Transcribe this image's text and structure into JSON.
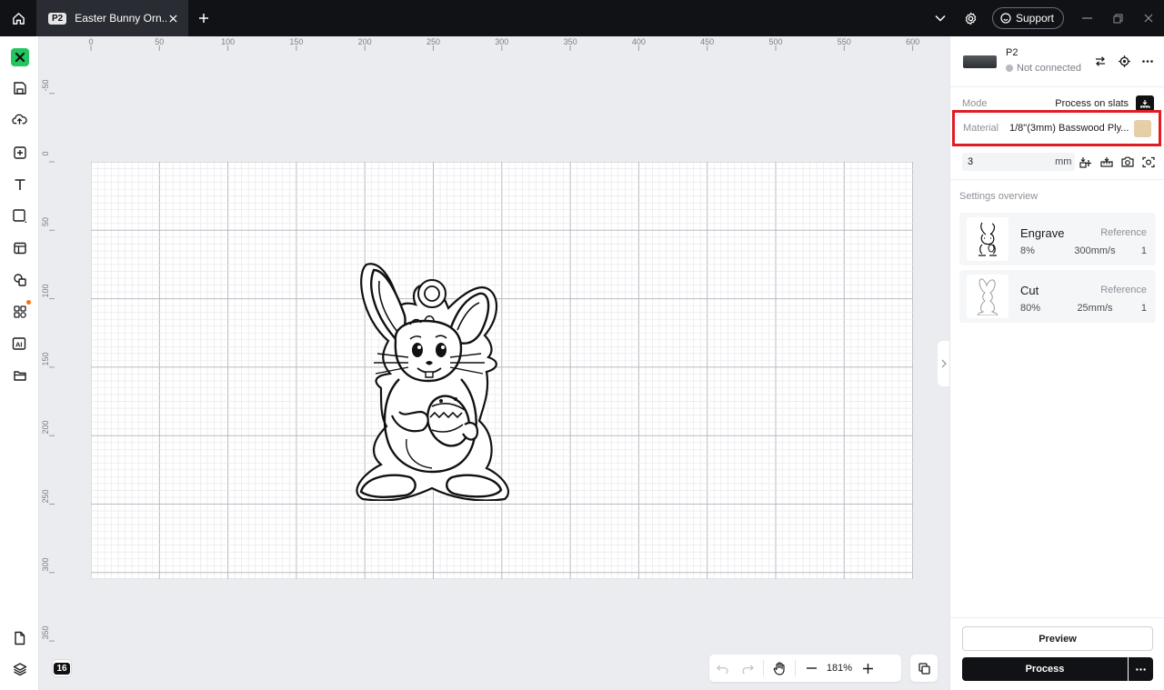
{
  "tab": {
    "badge": "P2",
    "title": "Easter Bunny Orn..."
  },
  "topbar": {
    "support_label": "Support"
  },
  "ruler": {
    "h_labels": [
      "0",
      "50",
      "100",
      "150",
      "200",
      "250",
      "300",
      "350",
      "400",
      "450",
      "500",
      "550",
      "600"
    ],
    "v_labels": [
      "-50",
      "0",
      "50",
      "100",
      "150",
      "200",
      "250",
      "300",
      "350"
    ]
  },
  "canvas": {
    "layers_count": "16",
    "zoom": "181%"
  },
  "device": {
    "name": "P2",
    "status": "Not connected"
  },
  "mode": {
    "label": "Mode",
    "value": "Process on slats"
  },
  "material": {
    "label": "Material",
    "value": "1/8\"(3mm) Basswood Ply...",
    "swatch_color": "#e4cfa9"
  },
  "thickness": {
    "value": "3",
    "unit": "mm"
  },
  "settings": {
    "title": "Settings overview",
    "items": [
      {
        "name": "Engrave",
        "reference": "Reference",
        "power": "8%",
        "speed": "300mm/s",
        "passes": "1"
      },
      {
        "name": "Cut",
        "reference": "Reference",
        "power": "80%",
        "speed": "25mm/s",
        "passes": "1"
      }
    ]
  },
  "actions": {
    "preview_label": "Preview",
    "process_label": "Process"
  },
  "colors": {
    "highlight": "#e11d23",
    "brand_green": "#22c55e",
    "dark": "#111216"
  }
}
